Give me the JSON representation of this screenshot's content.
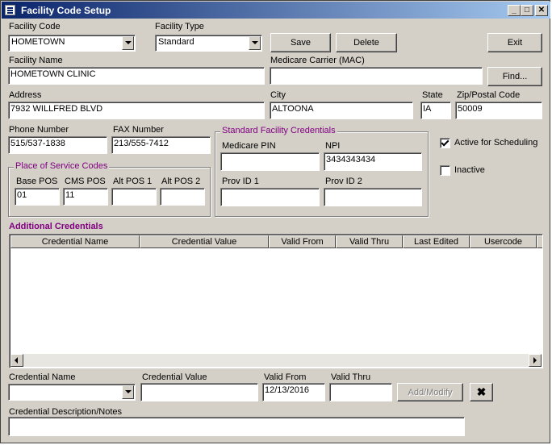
{
  "window": {
    "title": "Facility Code Setup",
    "buttons": {
      "minimize": "_",
      "maximize": "□",
      "close": "✕"
    }
  },
  "facility_code": {
    "label": "Facility Code",
    "value": "HOMETOWN"
  },
  "facility_type": {
    "label": "Facility Type",
    "value": "Standard"
  },
  "toolbar": {
    "save_label": "Save",
    "delete_label": "Delete",
    "exit_label": "Exit",
    "find_label": "Find..."
  },
  "facility_name": {
    "label": "Facility Name",
    "value": "HOMETOWN CLINIC"
  },
  "medicare_carrier": {
    "label": "Medicare Carrier (MAC)",
    "value": ""
  },
  "address": {
    "label": "Address",
    "value": "7932 WILLFRED BLVD"
  },
  "city": {
    "label": "City",
    "value": "ALTOONA"
  },
  "state": {
    "label": "State",
    "value": "IA"
  },
  "zip": {
    "label": "Zip/Postal Code",
    "value": "50009"
  },
  "phone": {
    "label": "Phone Number",
    "value": "515/537-1838"
  },
  "fax": {
    "label": "FAX Number",
    "value": "213/555-7412"
  },
  "pos": {
    "group_title": "Place of Service Codes",
    "base_label": "Base POS",
    "base_value": "01",
    "cms_label": "CMS POS",
    "cms_value": "11",
    "alt1_label": "Alt POS 1",
    "alt1_value": "",
    "alt2_label": "Alt POS 2",
    "alt2_value": ""
  },
  "standard_creds": {
    "group_title": "Standard Facility Credentials",
    "medicare_pin_label": "Medicare PIN",
    "medicare_pin_value": "",
    "npi_label": "NPI",
    "npi_value": "3434343434",
    "prov1_label": "Prov ID 1",
    "prov1_value": "",
    "prov2_label": "Prov ID 2",
    "prov2_value": ""
  },
  "status": {
    "active_label": "Active for Scheduling",
    "active_checked": true,
    "inactive_label": "Inactive",
    "inactive_checked": false
  },
  "additional_credentials": {
    "title": "Additional Credentials",
    "columns": [
      "Credential Name",
      "Credential Value",
      "Valid From",
      "Valid Thru",
      "Last Edited",
      "Usercode"
    ],
    "rows": []
  },
  "editor": {
    "cred_name_label": "Credential Name",
    "cred_name_value": "",
    "cred_value_label": "Credential Value",
    "cred_value_value": "",
    "valid_from_label": "Valid From",
    "valid_from_value": "12/13/2016",
    "valid_thru_label": "Valid Thru",
    "valid_thru_value": "",
    "add_modify_label": "Add/Modify",
    "clear_label": "✖",
    "notes_label": "Credential Description/Notes",
    "notes_value": ""
  }
}
